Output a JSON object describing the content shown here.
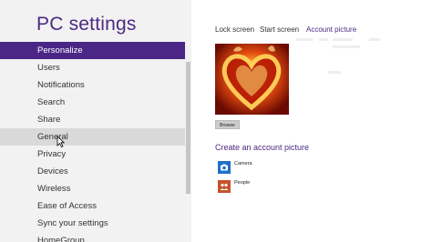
{
  "app": {
    "title": "PC settings"
  },
  "sidebar": {
    "items": [
      {
        "label": "Personalize"
      },
      {
        "label": "Users"
      },
      {
        "label": "Notifications"
      },
      {
        "label": "Search"
      },
      {
        "label": "Share"
      },
      {
        "label": "General"
      },
      {
        "label": "Privacy"
      },
      {
        "label": "Devices"
      },
      {
        "label": "Wireless"
      },
      {
        "label": "Ease of Access"
      },
      {
        "label": "Sync your settings"
      },
      {
        "label": "HomeGroup"
      }
    ],
    "selected_index": 0,
    "hovered_index": 5
  },
  "main": {
    "tabs": [
      {
        "label": "Lock screen"
      },
      {
        "label": "Start screen"
      },
      {
        "label": "Account picture"
      }
    ],
    "active_tab_index": 2,
    "browse_label": "Browse",
    "create_heading": "Create an account picture",
    "apps": [
      {
        "label": "Camera",
        "icon": "camera-icon",
        "color": "#1e6fc9"
      },
      {
        "label": "People",
        "icon": "people-icon",
        "color": "#c5522b"
      }
    ]
  },
  "colors": {
    "accent": "#4a2786",
    "title": "#4d2a82",
    "sidebar_bg": "#f2f2f2",
    "hover_bg": "#d9d9d9"
  }
}
